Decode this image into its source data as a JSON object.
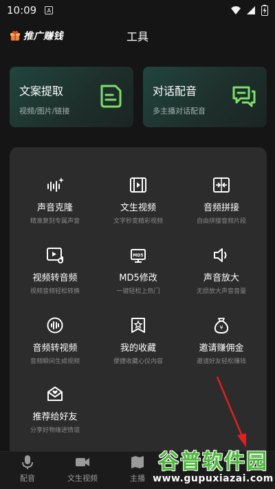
{
  "status_bar": {
    "time": "10:09",
    "badge": "A"
  },
  "header": {
    "brand": "推广赚钱",
    "title": "工具"
  },
  "top_cards": [
    {
      "title": "文案提取",
      "subtitle": "视频/图片/链接",
      "icon": "document-extract-icon"
    },
    {
      "title": "对话配音",
      "subtitle": "多主播对话配音",
      "icon": "chat-bubbles-icon"
    }
  ],
  "tools": [
    {
      "name": "声音克隆",
      "desc": "精准复刻专属声音",
      "icon": "voice-clone-icon"
    },
    {
      "name": "文生视频",
      "desc": "文字秒变精彩视频",
      "icon": "film-icon"
    },
    {
      "name": "音频拼接",
      "desc": "自由拼接音频片段",
      "icon": "audio-merge-icon"
    },
    {
      "name": "视频转音频",
      "desc": "视频音频轻松转换",
      "icon": "video-to-audio-icon"
    },
    {
      "name": "MD5修改",
      "desc": "一键轻松上热门",
      "icon": "md5-icon"
    },
    {
      "name": "声音放大",
      "desc": "无损放大声音音量",
      "icon": "speaker-icon"
    },
    {
      "name": "音频转视频",
      "desc": "音频瞬间生成视频",
      "icon": "audio-to-video-icon"
    },
    {
      "name": "我的收藏",
      "desc": "便捷收藏心仪内容",
      "icon": "star-bookmark-icon"
    },
    {
      "name": "邀请赚佣金",
      "desc": "邀请好友轻松赚钱",
      "icon": "money-bag-icon"
    },
    {
      "name": "推荐给好友",
      "desc": "分享好物缘进情谊",
      "icon": "share-mail-icon"
    }
  ],
  "bottom_nav": [
    {
      "label": "配音",
      "icon": "microphone-icon"
    },
    {
      "label": "文生视频",
      "icon": "video-camera-icon"
    },
    {
      "label": "主播",
      "icon": "anchor-icon"
    }
  ],
  "watermark": {
    "text": "谷普软件园",
    "url": "www.gupuxiazai.com"
  },
  "colors": {
    "background": "#151515",
    "panel": "#2c2c2c",
    "card": "#21453e",
    "accent_green": "#7ee06a",
    "arrow": "#e02020"
  }
}
